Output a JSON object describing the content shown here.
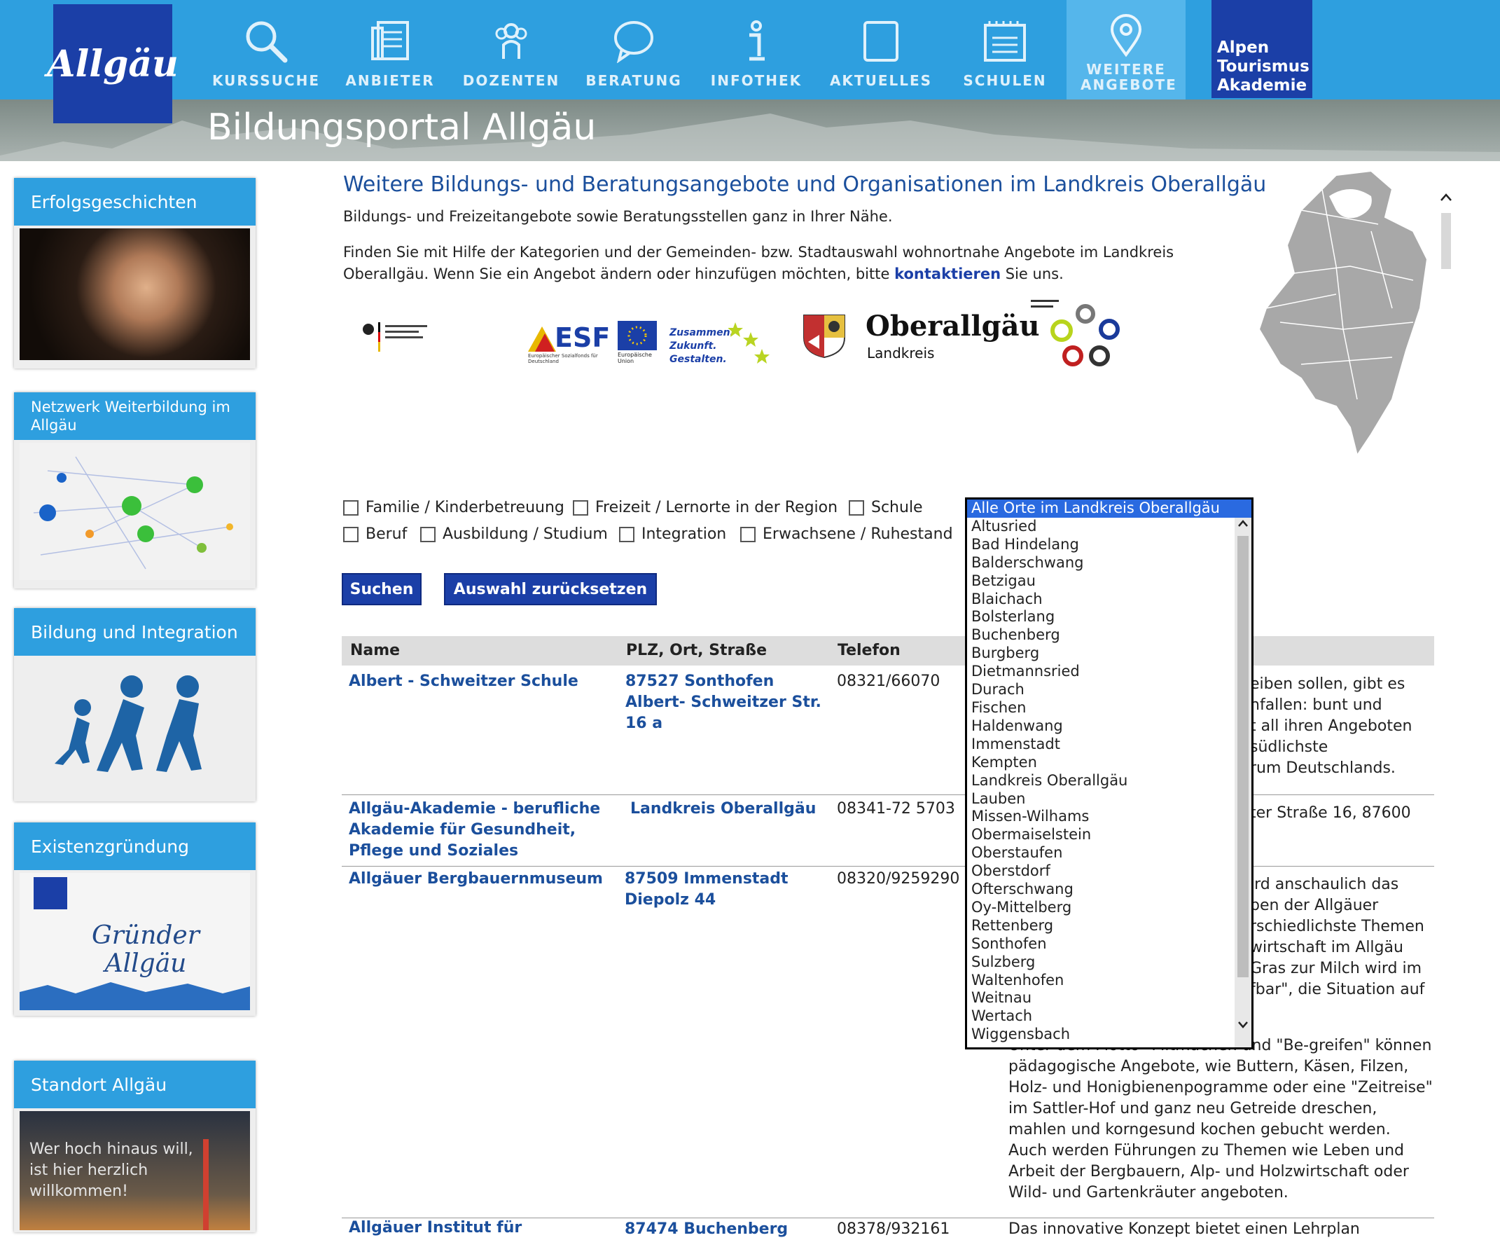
{
  "nav": {
    "logo": "Allgäu",
    "items": [
      {
        "label": "KURSSUCHE",
        "icon": "search-icon"
      },
      {
        "label": "ANBIETER",
        "icon": "document-icon"
      },
      {
        "label": "DOZENTEN",
        "icon": "people-icon"
      },
      {
        "label": "BERATUNG",
        "icon": "speech-bubble-icon"
      },
      {
        "label": "INFOTHEK",
        "icon": "info-icon"
      },
      {
        "label": "AKTUELLES",
        "icon": "tablet-icon"
      },
      {
        "label": "SCHULEN",
        "icon": "notepad-icon"
      },
      {
        "label": "WEITERE ANGEBOTE",
        "icon": "location-pin-icon"
      }
    ],
    "alpen": [
      "Alpen",
      "Tourismus",
      "Akademie"
    ]
  },
  "banner": {
    "title": "Bildungsportal Allgäu"
  },
  "sidebar": [
    {
      "title": "Erfolgsgeschichten"
    },
    {
      "title": "Netzwerk Weiterbildung im Allgäu"
    },
    {
      "title": "Bildung und Integration"
    },
    {
      "title": "Existenzgründung",
      "logo_text": "Gründer Allgäu"
    },
    {
      "title": "Standort Allgäu",
      "image_text": "Wer hoch hinaus will, ist hier herzlich willkommen!"
    }
  ],
  "main": {
    "title": "Weitere Bildungs- und Beratungsangebote und Organisationen im Landkreis Oberallgäu",
    "intro": "Bildungs- und Freizeitangebote sowie Beratungsstellen ganz in Ihrer Nähe.",
    "text1": "Finden Sie mit Hilfe der Kategorien und der Gemeinden- bzw. Stadtauswahl wohnortnahe Angebote im Landkreis",
    "text2a": "Oberallgäu. Wenn Sie ein Angebot ändern oder hinzufügen möchten, bitte",
    "text2link": "kontaktieren",
    "text2b": "Sie uns."
  },
  "logos": {
    "esf": "ESF",
    "esf_sub": "Europäischer Sozialfonds für Deutschland",
    "eu_sub": "Europäische Union",
    "zusammen": [
      "Zusammen.",
      "Zukunft.",
      "Gestalten."
    ],
    "oberallgaeu": "Oberallgäu",
    "landkreis": "Landkreis"
  },
  "filters": {
    "row1": [
      "Familie / Kinderbetreuung",
      "Freizeit / Lernorte in der Region",
      "Schule"
    ],
    "row2": [
      "Beruf",
      "Ausbildung / Studium",
      "Integration",
      "Erwachsene / Ruhestand"
    ],
    "search_button": "Suchen",
    "reset_button": "Auswahl zurücksetzen"
  },
  "places": {
    "selected": "Alle Orte im Landkreis Oberallgäu",
    "options": [
      "Altusried",
      "Bad Hindelang",
      "Balderschwang",
      "Betzigau",
      "Blaichach",
      "Bolsterlang",
      "Buchenberg",
      "Burgberg",
      "Dietmannsried",
      "Durach",
      "Fischen",
      "Haldenwang",
      "Immenstadt",
      "Kempten",
      "Landkreis Oberallgäu",
      "Lauben",
      "Missen-Wilhams",
      "Obermaiselstein",
      "Oberstaufen",
      "Oberstdorf",
      "Ofterschwang",
      "Oy-Mittelberg",
      "Rettenberg",
      "Sonthofen",
      "Sulzberg",
      "Waltenhofen",
      "Weitnau",
      "Wertach",
      "Wiggensbach"
    ]
  },
  "table": {
    "headers": {
      "name": "Name",
      "address": "PLZ, Ort, Straße",
      "phone": "Telefon"
    },
    "rows": [
      {
        "name": [
          "Albert - Schweitzer Schule"
        ],
        "address": [
          "87527 Sonthofen",
          "Albert- Schweitzer Str.",
          "16 a"
        ],
        "phone": "08321/66070",
        "desc": [
          "eiben sollen, gibt es",
          "nfallen: bunt und",
          "t all ihren Angeboten",
          "südlichste",
          "rum Deutschlands."
        ]
      },
      {
        "name": [
          "Allgäu-Akademie - berufliche",
          "Akademie für Gesundheit,",
          "Pflege und Soziales"
        ],
        "address": [
          "Landkreis Oberallgäu"
        ],
        "phone": "08341-72 5703",
        "desc": [
          "ter Straße 16, 87600"
        ]
      },
      {
        "name": [
          "Allgäuer Bergbauernmuseum"
        ],
        "address": [
          "87509 Immenstadt",
          "Diepolz 44"
        ],
        "phone": "08320/9259290",
        "desc": [
          "ird anschaulich das",
          "ben der Allgäuer",
          "rschiedlichste Themen",
          "wirtschaft im Allgäu",
          "Gras zur Milch wird im",
          "fbar\", die Situation auf"
        ]
      },
      {
        "name": [
          "Allgäuer Institut für"
        ],
        "address": [
          "87474 Buchenberg"
        ],
        "phone": "08378/932161",
        "desc": [
          "Das innovative Konzept bietet einen Lehrplan"
        ]
      }
    ],
    "desc_full": [
      "Unter dem Motto \"Mitmachen und \"Be-greifen\" können",
      "pädagogische Angebote, wie Buttern, Käsen, Filzen,",
      "Holz- und Honigbienenpogramme oder eine \"Zeitreise\"",
      "im Sattler-Hof und ganz neu Getreide dreschen,",
      "mahlen und korngesund kochen gebucht werden.",
      "Auch werden Führungen zu Themen wie Leben und",
      "Arbeit der Bergbauern, Alp- und Holzwirtschaft oder",
      "Wild- und Gartenkräuter angeboten."
    ]
  },
  "colors": {
    "brand_blue": "#1b3fa7",
    "nav_blue": "#2e9fdf",
    "link_blue": "#1b4f9c",
    "select_highlight": "#2a6ae0"
  }
}
